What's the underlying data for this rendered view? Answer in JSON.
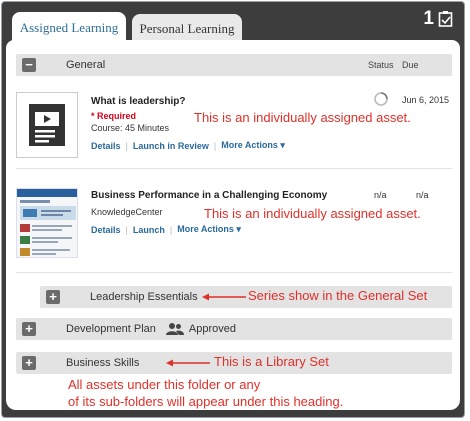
{
  "tabs": [
    {
      "label": "Assigned Learning",
      "active": true
    },
    {
      "label": "Personal Learning",
      "active": false
    }
  ],
  "header_count": "1",
  "general_section": {
    "title": "General",
    "status_col": "Status",
    "due_col": "Due",
    "toggle": "−"
  },
  "items": [
    {
      "title": "What is leadership?",
      "required": "* Required",
      "meta": "Course: 45 Minutes",
      "due": "Jun 6, 2015",
      "actions": [
        "Details",
        "Launch in Review",
        "More Actions ▾"
      ],
      "annotation": "This is an individually assigned asset."
    },
    {
      "title": "Business Performance in a Challenging Economy",
      "meta": "KnowledgeCenter",
      "status": "n/a",
      "due": "n/a",
      "actions": [
        "Details",
        "Launch",
        "More Actions ▾"
      ],
      "annotation": "This is an individually assigned asset."
    }
  ],
  "sets": [
    {
      "toggle": "+",
      "title": "Leadership Essentials",
      "annotation": "Series show in the General Set"
    },
    {
      "toggle": "+",
      "title": "Development Plan",
      "badge": "Approved"
    },
    {
      "toggle": "+",
      "title": "Business Skills",
      "annotation": "This is a Library Set"
    }
  ],
  "footer_note_line1": "All assets under this folder or any",
  "footer_note_line2": "of its sub-folders will appear under this heading.",
  "colors": {
    "accent": "#2e6f98",
    "annotation": "#e0302a",
    "required": "#d0021b",
    "link": "#2a6a9c"
  }
}
